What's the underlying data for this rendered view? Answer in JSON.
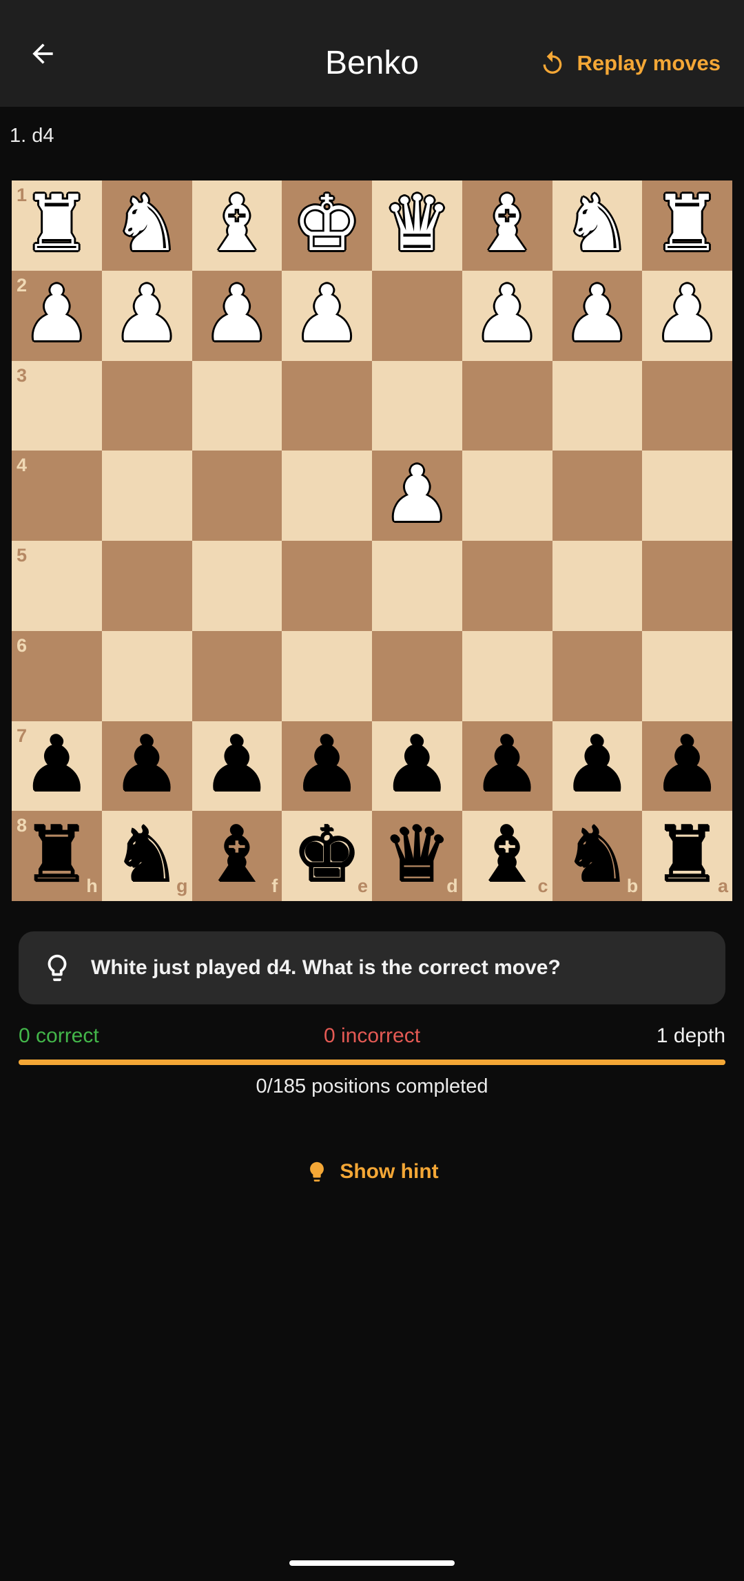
{
  "header": {
    "title": "Benko",
    "replay_label": "Replay moves"
  },
  "moves_text": "1. d4",
  "board": {
    "orientation": "black-bottom",
    "files_bottom": [
      "h",
      "g",
      "f",
      "e",
      "d",
      "c",
      "b",
      "a"
    ],
    "ranks_left": [
      "1",
      "2",
      "3",
      "4",
      "5",
      "6",
      "7",
      "8"
    ],
    "light_color": "#f0d9b5",
    "dark_color": "#b58863",
    "rows": [
      [
        "wR",
        "wN",
        "wB",
        "wK",
        "wQ",
        "wB",
        "wN",
        "wR"
      ],
      [
        "wP",
        "wP",
        "wP",
        "wP",
        "",
        "wP",
        "wP",
        "wP"
      ],
      [
        "",
        "",
        "",
        "",
        "",
        "",
        "",
        ""
      ],
      [
        "",
        "",
        "",
        "",
        "wP",
        "",
        "",
        ""
      ],
      [
        "",
        "",
        "",
        "",
        "",
        "",
        "",
        ""
      ],
      [
        "",
        "",
        "",
        "",
        "",
        "",
        "",
        ""
      ],
      [
        "bP",
        "bP",
        "bP",
        "bP",
        "bP",
        "bP",
        "bP",
        "bP"
      ],
      [
        "bR",
        "bN",
        "bB",
        "bK",
        "bQ",
        "bB",
        "bN",
        "bR"
      ]
    ]
  },
  "prompt": {
    "icon": "lightbulb-outline-icon",
    "text": "White just played d4. What is the correct move?"
  },
  "stats": {
    "correct": "0 correct",
    "incorrect": "0 incorrect",
    "depth": "1 depth",
    "correct_color": "#43b64a",
    "incorrect_color": "#e45a54"
  },
  "progress": {
    "fraction": 1.0,
    "color": "#f4a736"
  },
  "positions_text": "0/185 positions completed",
  "hint": {
    "label": "Show hint",
    "icon": "lightbulb-filled-icon"
  },
  "accent_color": "#f4a736"
}
